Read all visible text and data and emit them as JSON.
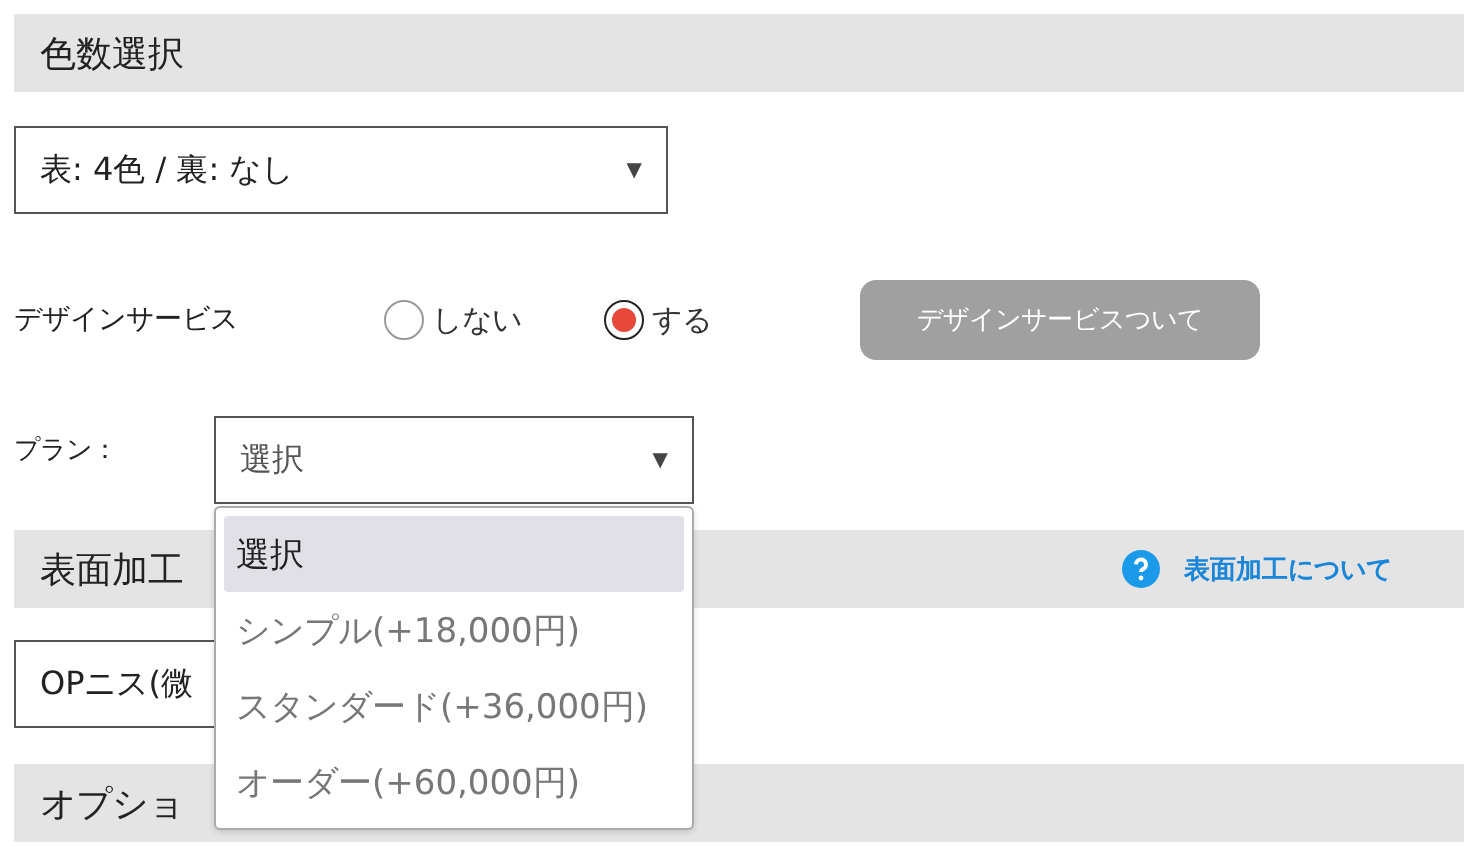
{
  "color_section": {
    "title": "色数選択"
  },
  "color_select": {
    "value": "表: 4色 / 裏: なし",
    "arrow": "▼"
  },
  "design_service": {
    "label": "デザインサービス",
    "options": [
      {
        "label": "しない",
        "selected": false
      },
      {
        "label": "する",
        "selected": true
      }
    ],
    "button": "デザインサービスついて"
  },
  "plan": {
    "label": "プラン：",
    "value": "選択",
    "arrow": "▼",
    "expanded": true,
    "options": [
      {
        "label": "選択",
        "selected": true
      },
      {
        "label": "シンプル(+18,000円)",
        "selected": false
      },
      {
        "label": "スタンダード(+36,000円)",
        "selected": false
      },
      {
        "label": "オーダー(+60,000円)",
        "selected": false
      }
    ]
  },
  "surface_section": {
    "title": "表面加工",
    "help_link": "表面加工について"
  },
  "surface_select": {
    "value": "OPニス(微"
  },
  "option_section": {
    "title": "オプショ"
  }
}
